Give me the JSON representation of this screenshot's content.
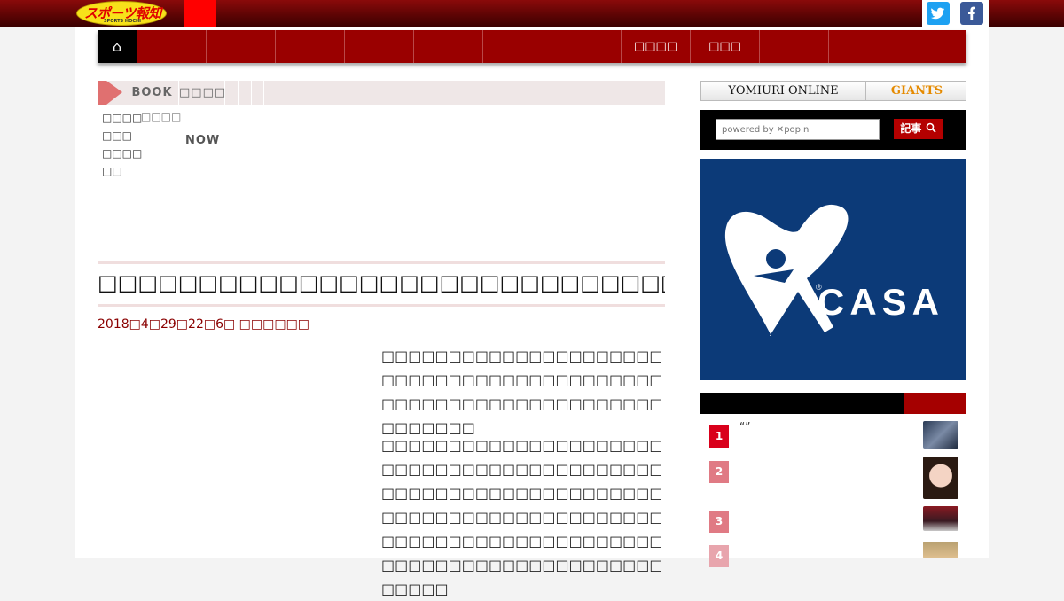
{
  "header": {
    "logo_text": "スポーツ報知",
    "logo_sub": "SPORTS HOCHI",
    "twitter_icon_glyph": "t",
    "facebook_icon_glyph": "f"
  },
  "nav": {
    "home_glyph": "⌂",
    "items": [
      "",
      "",
      "",
      "",
      "",
      "",
      "",
      "□□□□",
      "□□□",
      "",
      ""
    ]
  },
  "breadcrumb": {
    "items": [
      "BOOK",
      "□□□□",
      "",
      "",
      ""
    ]
  },
  "subcategories": {
    "col1": [
      "□□□□",
      "□□□",
      "□□□□",
      "□□"
    ],
    "col2": "□□□□",
    "now": "NOW"
  },
  "article": {
    "title": "□□□□□□□□□□□□□□□□□□□□□□□□□□□□□□□□□□□□□□",
    "meta": "2018□4□29□22□6□  □□□□□□",
    "paragraphs": [
      "□□□□□□□□□□□□□□□□□□□□□□□□□□□□□□□□□□□□□□□□□□□□□□□□□□□□□□□□□□□□□□□□□□□□□□",
      "□□□□□□□□□□□□□□□□□□□□□□□□□□□□□□□□□□□□□□□□□□□□□□□□□□□□□□□□□□□□□□□□□□□□□□□□□□□□□□□□□□□□□□□□□□□□□□□□□□□□□□□□□□□□□□□□□□□□□□□□□□□□□□□□□□□"
    ]
  },
  "sidebar": {
    "yomiuri_label": "YOMIURI ONLINE",
    "giants_label": "GIANTS",
    "search_placeholder": "powered by ✕popIn",
    "search_button": "記事",
    "ad_text": "CASA",
    "ranking": [
      {
        "rank": "1",
        "text": "“”",
        "color": "#d9001b"
      },
      {
        "rank": "2",
        "text": "",
        "color": "#e07a84"
      },
      {
        "rank": "3",
        "text": "",
        "color": "#e07a84"
      },
      {
        "rank": "4",
        "text": "",
        "color": "#e8a5ad"
      }
    ]
  },
  "colors": {
    "brand_red": "#9a0000",
    "accent_red": "#ff0000",
    "ad_blue": "#0c3a78"
  }
}
